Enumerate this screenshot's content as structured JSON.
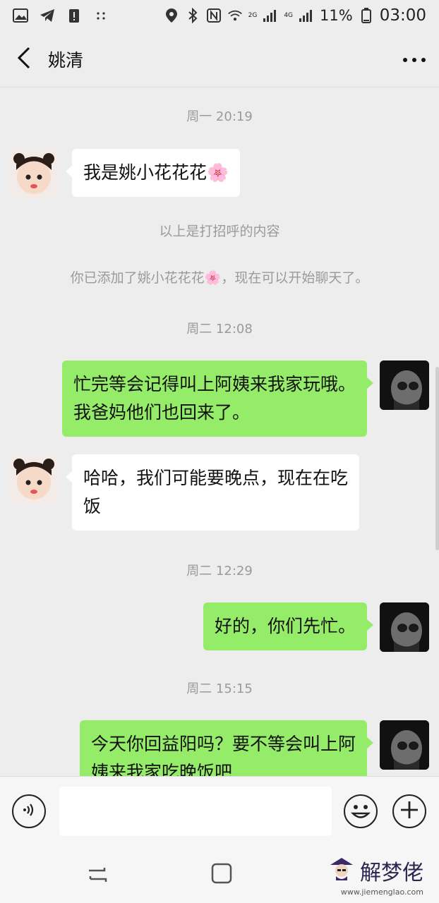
{
  "status_bar": {
    "battery": "11%",
    "time": "03:00",
    "network": "2G",
    "network2": "4G"
  },
  "header": {
    "title": "姚清",
    "back_icon": "chevron-left-icon",
    "more_icon": "more-dots-icon"
  },
  "chat": {
    "t1": "周一 20:19",
    "m1": "我是姚小花花花🌸",
    "s1": "以上是打招呼的内容",
    "s2": "你已添加了姚小花花花🌸，现在可以开始聊天了。",
    "t2": "周二 12:08",
    "m2_l1": "忙完等会记得叫上阿姨来我家玩哦。",
    "m2_l2": "我爸妈他们也回来了。",
    "m3_l1": "哈哈，我们可能要晚点，现在在吃",
    "m3_l2": "饭",
    "t3": "周二 12:29",
    "m4": "好的，你们先忙。",
    "t4": "周二 15:15",
    "m5_l1": "今天你回益阳吗？要不等会叫上阿",
    "m5_l2": "姨来我家吃晚饭吧"
  },
  "input_bar": {
    "text_value": "",
    "voice_icon": "voice-icon",
    "emoji_icon": "emoji-icon",
    "plus_icon": "plus-icon"
  },
  "watermark": {
    "brand": "解梦佬",
    "url": "www.jiemenglao.com"
  },
  "colors": {
    "outgoing_bubble": "#95ec69",
    "incoming_bubble": "#ffffff",
    "background": "#ededed"
  }
}
